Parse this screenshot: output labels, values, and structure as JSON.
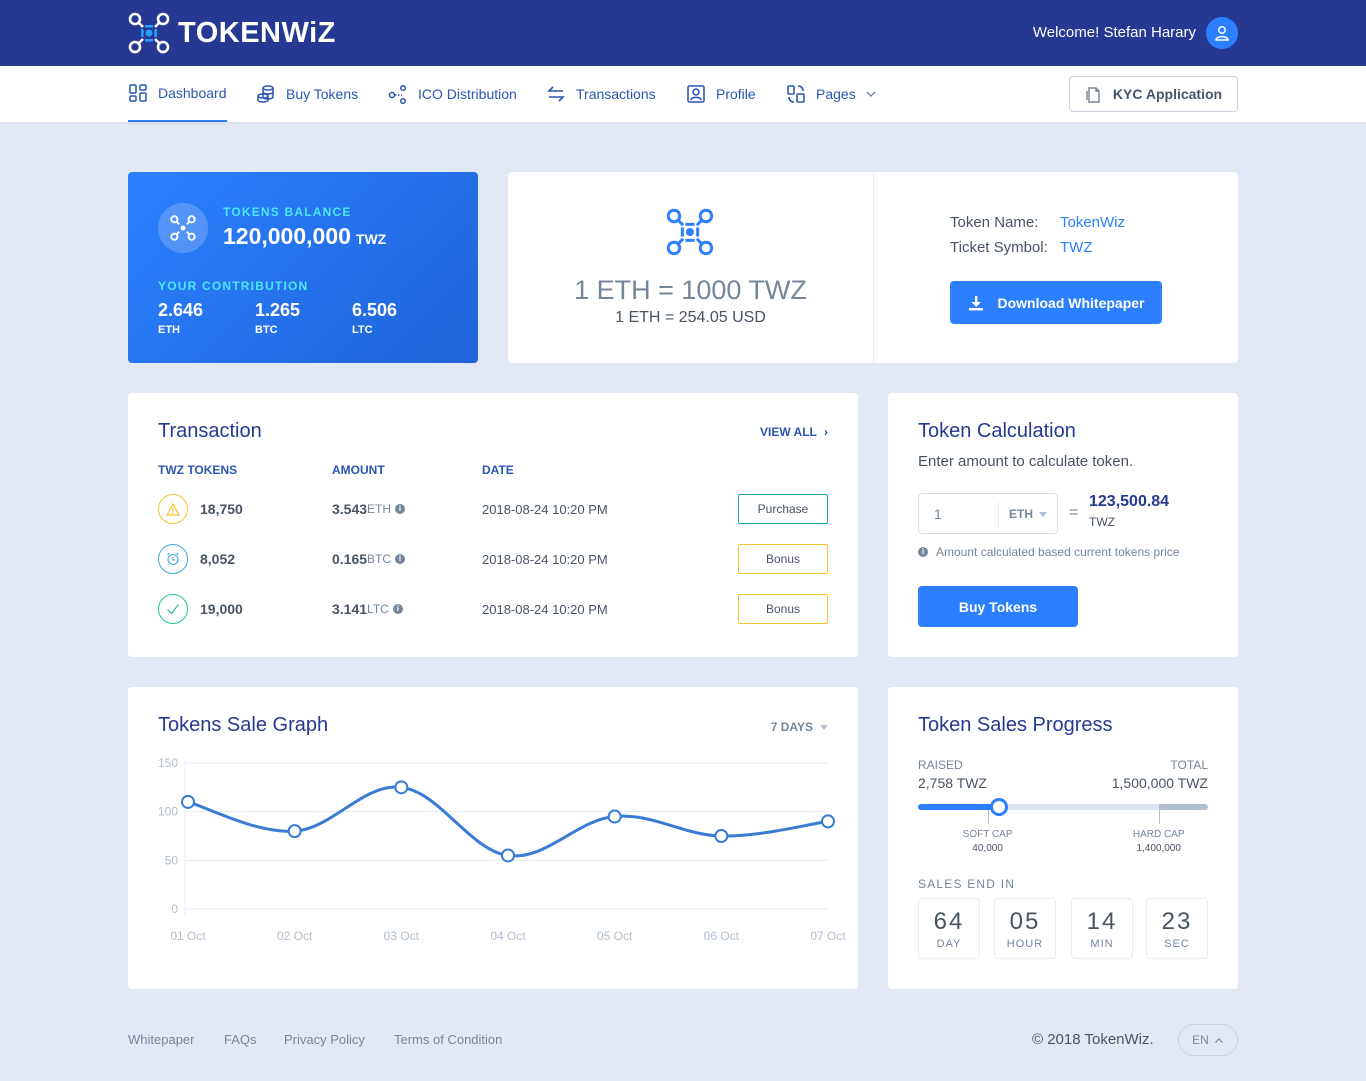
{
  "header": {
    "brand": "TOKENWiZ",
    "welcome": "Welcome! Stefan Harary"
  },
  "nav": {
    "items": [
      {
        "label": "Dashboard",
        "icon": "dashboard-icon",
        "active": true
      },
      {
        "label": "Buy Tokens",
        "icon": "coins-icon"
      },
      {
        "label": "ICO Distribution",
        "icon": "distribution-icon"
      },
      {
        "label": "Transactions",
        "icon": "exchange-icon"
      },
      {
        "label": "Profile",
        "icon": "user-card-icon"
      },
      {
        "label": "Pages",
        "icon": "pages-icon"
      }
    ],
    "kyc_label": "KYC Application"
  },
  "balance": {
    "label": "TOKENS BALANCE",
    "value": "120,000,000",
    "unit": "TWZ",
    "contribution_label": "YOUR CONTRIBUTION",
    "contributions": [
      {
        "value": "2.646",
        "currency": "ETH"
      },
      {
        "value": "1.265",
        "currency": "BTC"
      },
      {
        "value": "6.506",
        "currency": "LTC"
      }
    ]
  },
  "rate": {
    "main": "1 ETH = 1000 TWZ",
    "sub": "1 ETH = 254.05 USD",
    "token_name_label": "Token Name:",
    "token_name": "TokenWiz",
    "symbol_label": "Ticket Symbol:",
    "symbol": "TWZ",
    "download_label": "Download Whitepaper"
  },
  "transactions": {
    "title": "Transaction",
    "view_all": "VIEW ALL",
    "headers": {
      "tokens": "TWZ TOKENS",
      "amount": "AMOUNT",
      "date": "DATE"
    },
    "rows": [
      {
        "tokens": "18,750",
        "amount": "3.543",
        "currency": "ETH",
        "date": "2018-08-24 10:20 PM",
        "type": "Purchase",
        "status_icon": "warning-icon",
        "color": "#f7c32f",
        "btn_color": "#1aa59a"
      },
      {
        "tokens": "8,052",
        "amount": "0.165",
        "currency": "BTC",
        "date": "2018-08-24 10:20 PM",
        "type": "Bonus",
        "status_icon": "alarm-clock-icon",
        "color": "#3ba9d4",
        "btn_color": "#f7c32f"
      },
      {
        "tokens": "19,000",
        "amount": "3.141",
        "currency": "LTC",
        "date": "2018-08-24 10:20 PM",
        "type": "Bonus",
        "status_icon": "check-icon",
        "color": "#1ec68d",
        "btn_color": "#f7c32f"
      }
    ]
  },
  "calculator": {
    "title": "Token Calculation",
    "subtitle": "Enter amount to calculate token.",
    "amount": "1",
    "currency": "ETH",
    "equals": "=",
    "result": "123,500.84",
    "result_unit": "TWZ",
    "note": "Amount calculated based current tokens price",
    "buy_label": "Buy Tokens"
  },
  "graph": {
    "title": "Tokens Sale Graph",
    "range": "7 DAYS"
  },
  "chart_data": {
    "type": "line",
    "title": "Tokens Sale Graph",
    "categories": [
      "01 Oct",
      "02 Oct",
      "03 Oct",
      "04 Oct",
      "05 Oct",
      "06 Oct",
      "07 Oct"
    ],
    "values": [
      110,
      80,
      125,
      55,
      95,
      75,
      90
    ],
    "yticks": [
      0,
      50,
      100,
      150
    ],
    "ylim": [
      0,
      150
    ],
    "xlabel": "",
    "ylabel": "",
    "grid": true,
    "color": "#2c80ff"
  },
  "progress": {
    "title": "Token Sales Progress",
    "raised_label": "RAISED",
    "raised": "2,758 TWZ",
    "total_label": "TOTAL",
    "total": "1,500,000 TWZ",
    "fill_fraction": 0.28,
    "soft_cap_label": "SOFT CAP",
    "soft_cap": "40,000",
    "soft_cap_fraction": 0.24,
    "hard_cap_label": "HARD CAP",
    "hard_cap": "1,400,000",
    "hard_cap_fraction": 0.83,
    "ends_label": "SALES END IN",
    "countdown": [
      {
        "value": "64",
        "unit": "DAY"
      },
      {
        "value": "05",
        "unit": "HOUR"
      },
      {
        "value": "14",
        "unit": "MIN"
      },
      {
        "value": "23",
        "unit": "SEC"
      }
    ]
  },
  "footer": {
    "links": [
      "Whitepaper",
      "FAQs",
      "Privacy Policy",
      "Terms of Condition"
    ],
    "copyright": "© 2018 TokenWiz.",
    "language": "EN"
  }
}
